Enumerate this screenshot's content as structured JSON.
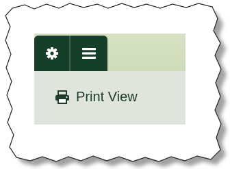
{
  "toolbar": {
    "settings_button": {
      "icon": "gear-icon"
    },
    "menu_button": {
      "icon": "hamburger-menu-icon"
    }
  },
  "dropdown": {
    "items": [
      {
        "label": "Print View",
        "icon": "printer-icon"
      }
    ]
  },
  "colors": {
    "button_bg": "#163f2a",
    "toolbar_bg": "#d4e0bf",
    "dropdown_bg": "#dfe5dc",
    "text": "#1f3b2c"
  }
}
